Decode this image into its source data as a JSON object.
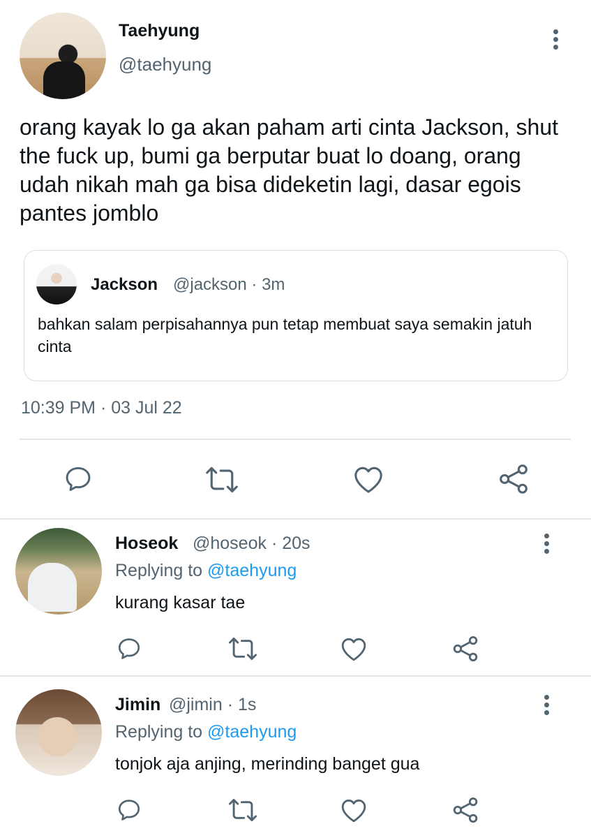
{
  "tweet": {
    "author_name": "Taehyung",
    "author_handle": "@taehyung",
    "text": "orang kayak lo ga akan paham arti cinta Jackson, shut the fuck up, bumi ga berputar buat lo doang, orang udah nikah mah ga bisa dideketin lagi, dasar egois pantes jomblo",
    "timestamp": "10:39 PM · 03 Jul 22",
    "quoted": {
      "author_name": "Jackson",
      "author_meta": "@jackson · 3m",
      "text": "bahkan salam perpisahannya pun tetap membuat saya semakin jatuh cinta"
    },
    "actions": [
      "reply-icon",
      "retweet-icon",
      "like-icon",
      "share-icon"
    ]
  },
  "replies": [
    {
      "author_name": "Hoseok",
      "author_meta": "@hoseok · 20s",
      "replying_label": "Replying to",
      "replying_handle": "@taehyung",
      "text": "kurang kasar tae"
    },
    {
      "author_name": "Jimin",
      "author_meta": "@jimin · 1s",
      "replying_label": "Replying to",
      "replying_handle": "@taehyung",
      "text": "tonjok aja anjing, merinding banget gua"
    }
  ],
  "colors": {
    "text": "#0f1419",
    "muted": "#536471",
    "link": "#1d9bf0",
    "divider": "#dfe5e9"
  }
}
